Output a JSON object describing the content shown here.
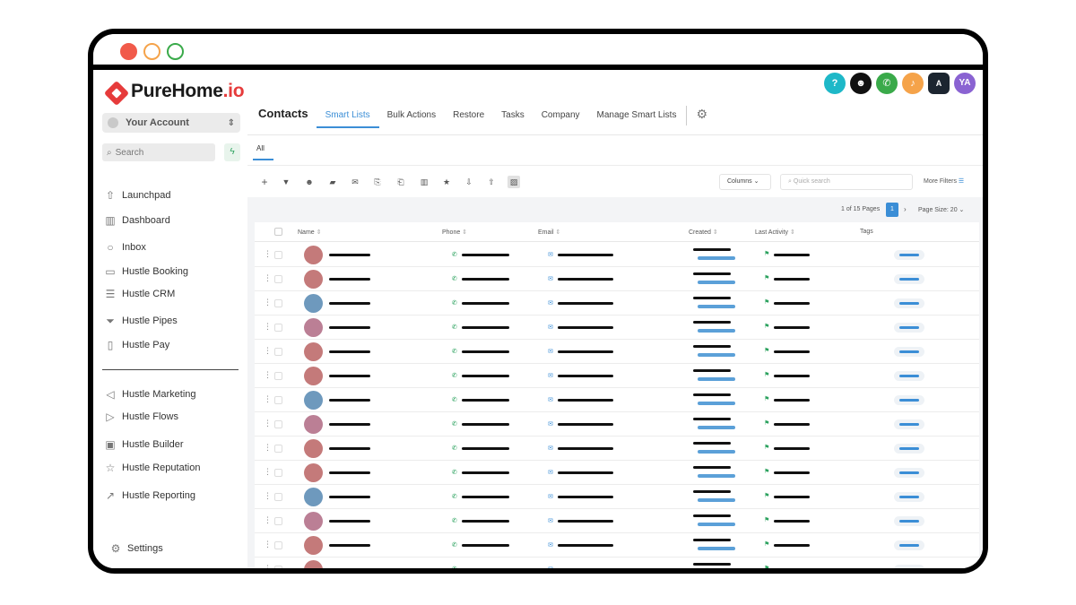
{
  "window": {
    "controls": [
      "close",
      "minimize",
      "maximize"
    ]
  },
  "brand": {
    "name": "PureHome",
    "suffix": ".io",
    "accent": "#e63b3b"
  },
  "account": {
    "label": "Your Account"
  },
  "search": {
    "placeholder": "Search"
  },
  "nav": {
    "items": [
      {
        "label": "Launchpad",
        "icon": "rocket-icon"
      },
      {
        "label": "Dashboard",
        "icon": "dashboard-icon"
      },
      {
        "label": "Inbox",
        "icon": "chat-bubble-icon"
      },
      {
        "label": "Hustle Booking",
        "icon": "calendar-icon"
      },
      {
        "label": "Hustle CRM",
        "icon": "list-icon"
      },
      {
        "label": "Hustle Pipes",
        "icon": "funnel-icon"
      },
      {
        "label": "Hustle Pay",
        "icon": "receipt-icon"
      },
      {
        "label": "Hustle Marketing",
        "icon": "send-icon"
      },
      {
        "label": "Hustle Flows",
        "icon": "play-icon"
      },
      {
        "label": "Hustle Builder",
        "icon": "browser-icon"
      },
      {
        "label": "Hustle Reputation",
        "icon": "star-icon"
      },
      {
        "label": "Hustle Reporting",
        "icon": "trend-icon"
      }
    ],
    "settings": "Settings"
  },
  "header": {
    "title": "Contacts",
    "tabs": [
      "Smart Lists",
      "Bulk Actions",
      "Restore",
      "Tasks",
      "Company",
      "Manage Smart Lists"
    ],
    "active_tab": "Smart Lists",
    "icons": [
      {
        "name": "help-icon",
        "glyph": "?",
        "color": "#1eb8c8"
      },
      {
        "name": "bot-icon",
        "glyph": "☻",
        "color": "#111111"
      },
      {
        "name": "phone-icon",
        "glyph": "✆",
        "color": "#3aaa4a"
      },
      {
        "name": "bell-icon",
        "glyph": "♪",
        "color": "#f5a34a"
      },
      {
        "name": "translate-icon",
        "glyph": "A",
        "color": "#1c2530"
      },
      {
        "name": "user-avatar-icon",
        "glyph": "YA",
        "color": "#8a63d2"
      }
    ]
  },
  "subtabs": {
    "all": "All"
  },
  "toolbar": {
    "columns": "Columns",
    "quick_search_placeholder": "Quick search",
    "more_filters": "More Filters"
  },
  "pagination": {
    "summary": "1 of 15 Pages",
    "current_page": "1",
    "page_size": "Page Size: 20"
  },
  "table": {
    "columns": [
      "Name",
      "Phone",
      "Email",
      "Created",
      "Last Activity",
      "Tags"
    ],
    "rows": [
      {
        "avatar_color": "#c47a7a"
      },
      {
        "avatar_color": "#c47a7a"
      },
      {
        "avatar_color": "#6e99bd"
      },
      {
        "avatar_color": "#bb7f95"
      },
      {
        "avatar_color": "#c47a7a"
      },
      {
        "avatar_color": "#c47a7a"
      },
      {
        "avatar_color": "#6e99bd"
      },
      {
        "avatar_color": "#bb7f95"
      },
      {
        "avatar_color": "#c47a7a"
      },
      {
        "avatar_color": "#c47a7a"
      },
      {
        "avatar_color": "#6e99bd"
      },
      {
        "avatar_color": "#bb7f95"
      },
      {
        "avatar_color": "#c47a7a"
      },
      {
        "avatar_color": "#c47a7a"
      }
    ]
  }
}
